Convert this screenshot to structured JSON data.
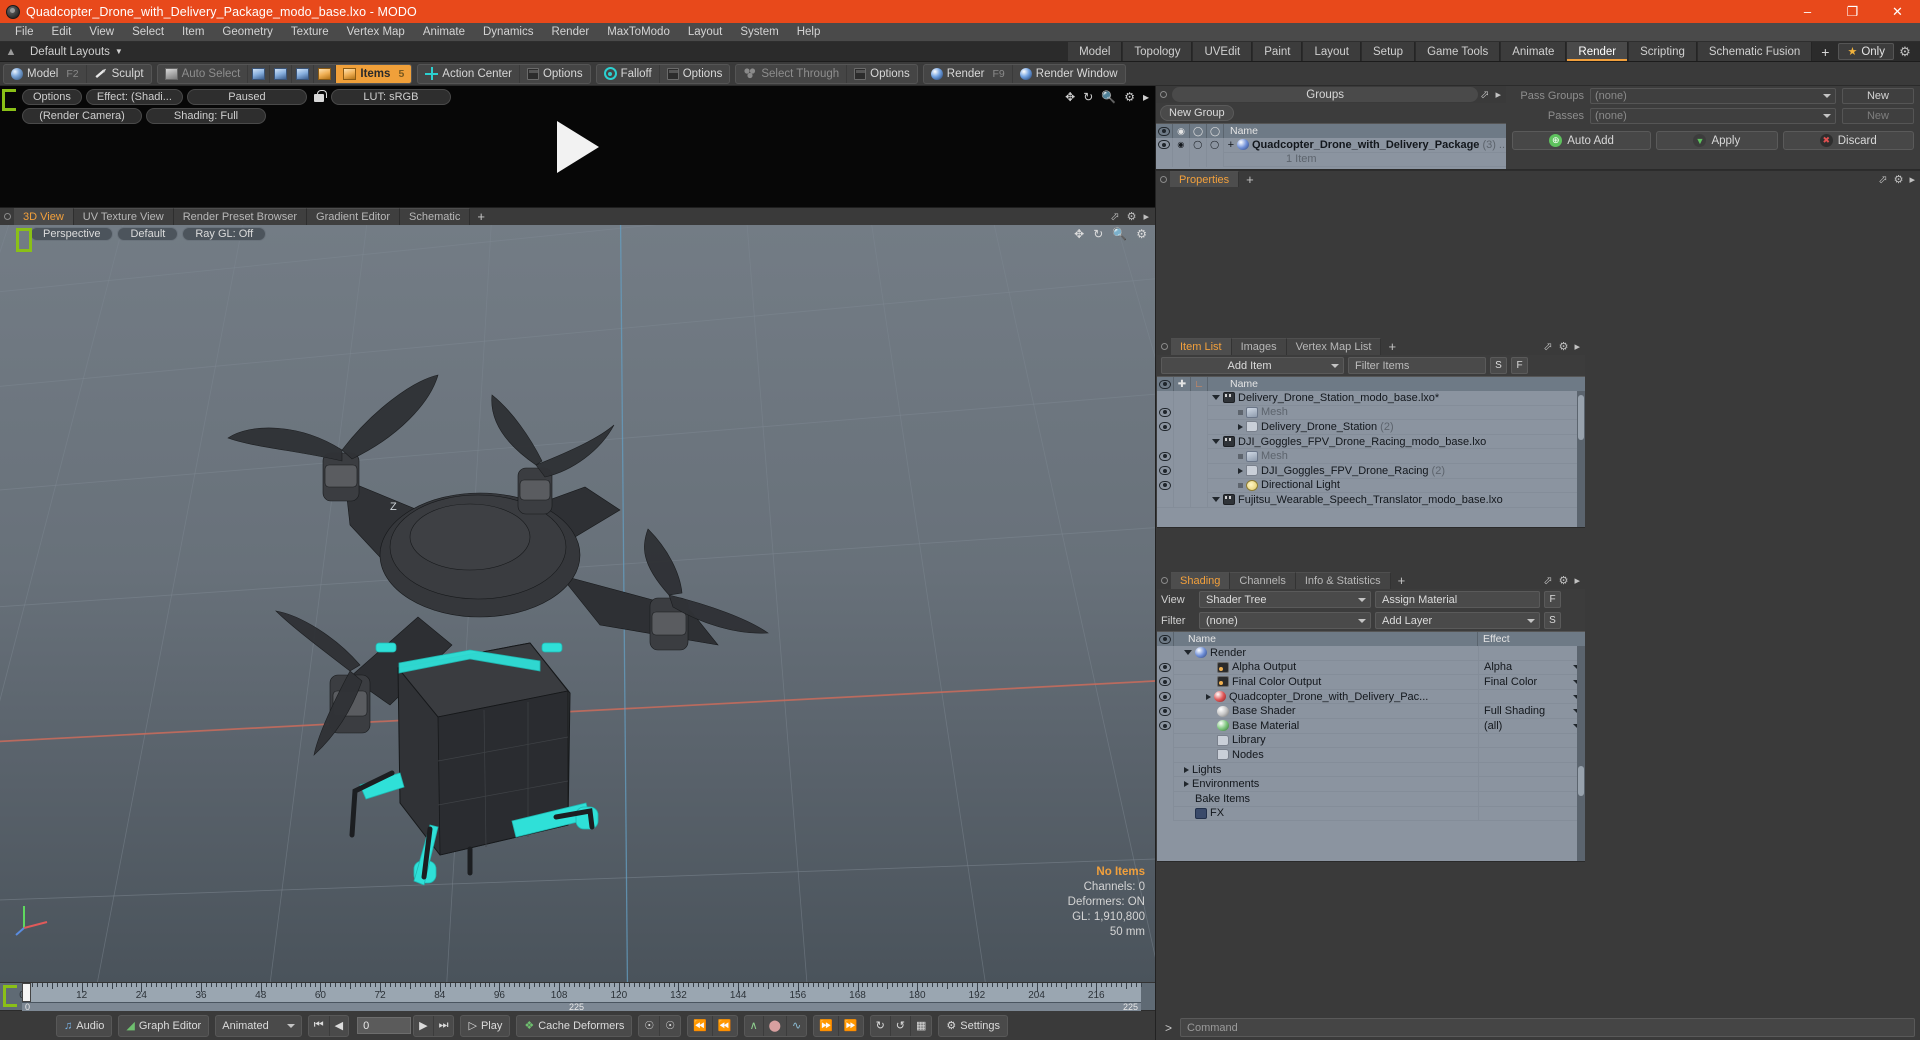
{
  "window": {
    "title": "Quadcopter_Drone_with_Delivery_Package_modo_base.lxo - MODO",
    "minimize": "–",
    "maximize": "❐",
    "close": "✕"
  },
  "menu": {
    "items": [
      "File",
      "Edit",
      "View",
      "Select",
      "Item",
      "Geometry",
      "Texture",
      "Vertex Map",
      "Animate",
      "Dynamics",
      "Render",
      "MaxToModo",
      "Layout",
      "System",
      "Help"
    ]
  },
  "layout_bar": {
    "default_layouts": "Default Layouts",
    "tabs": [
      {
        "label": "Model",
        "active": false
      },
      {
        "label": "Topology",
        "active": false
      },
      {
        "label": "UVEdit",
        "active": false
      },
      {
        "label": "Paint",
        "active": false
      },
      {
        "label": "Layout",
        "active": false
      },
      {
        "label": "Setup",
        "active": false
      },
      {
        "label": "Game Tools",
        "active": false
      },
      {
        "label": "Animate",
        "active": false
      },
      {
        "label": "Render",
        "active": true
      },
      {
        "label": "Scripting",
        "active": false
      },
      {
        "label": "Schematic Fusion",
        "active": false
      }
    ],
    "add_tab": "+",
    "only_label": "Only"
  },
  "toolbar": {
    "mode_group": [
      {
        "label": "Model",
        "key": "F2",
        "icon": "sphere-icon",
        "active": false
      },
      {
        "label": "Sculpt",
        "key": "",
        "icon": "brush-icon",
        "active": false
      }
    ],
    "auto_select": {
      "label": "Auto Select",
      "icon": "cube-icon"
    },
    "selection_modes": [
      "vertex-select-icon",
      "edge-select-icon",
      "polygon-select-icon",
      "material-select-icon"
    ],
    "items_btn": {
      "label": "Items",
      "key": "5",
      "icon": "items-cube-icon",
      "active": true
    },
    "action_center": {
      "label": "Action Center",
      "icon": "action-center-icon"
    },
    "options1": {
      "label": "Options",
      "icon": "options-box-icon"
    },
    "falloff": {
      "label": "Falloff",
      "icon": "falloff-icon"
    },
    "options2": {
      "label": "Options",
      "icon": "options-box-icon"
    },
    "select_through": {
      "label": "Select Through",
      "icon": "select-through-icon"
    },
    "options3": {
      "label": "Options",
      "icon": "options-box-icon"
    },
    "render": {
      "label": "Render",
      "key": "F9",
      "icon": "render-sphere-icon"
    },
    "render_window": {
      "label": "Render Window",
      "icon": "render-window-icon"
    }
  },
  "preview": {
    "options": "Options",
    "effect": "Effect: (Shadi...",
    "paused": "Paused",
    "lut": "LUT: sRGB",
    "camera": "(Render Camera)",
    "shading": "Shading: Full",
    "lock_icon": "unlocked-padlock-icon"
  },
  "viewport_tabs": {
    "tabs": [
      {
        "label": "3D View",
        "active": true
      },
      {
        "label": "UV Texture View",
        "active": false
      },
      {
        "label": "Render Preset Browser",
        "active": false
      },
      {
        "label": "Gradient Editor",
        "active": false
      },
      {
        "label": "Schematic",
        "active": false
      }
    ],
    "add_tab": "+"
  },
  "viewport": {
    "perspective": "Perspective",
    "preset": "Default",
    "raygl": "Ray GL: Off",
    "axis_z": "Z",
    "info": {
      "items": "No Items",
      "channels": "Channels: 0",
      "deformers": "Deformers: ON",
      "gl": "GL: 1,910,800",
      "scale": "50 mm"
    }
  },
  "timeline": {
    "ticks": [
      "0",
      "12",
      "24",
      "36",
      "48",
      "60",
      "72",
      "84",
      "96",
      "108",
      "120",
      "132",
      "144",
      "156",
      "168",
      "180",
      "192",
      "204",
      "216"
    ],
    "range_start": "0",
    "range_current": "225",
    "range_end": "225"
  },
  "bottom_bar": {
    "audio": "Audio",
    "graph_editor": "Graph Editor",
    "animated": "Animated",
    "frame_value": "0",
    "play": "Play",
    "cache_deformers": "Cache Deformers",
    "settings": "Settings",
    "transport": [
      "go-to-start-icon",
      "step-back-icon",
      "step-forward-icon",
      "go-to-end-icon"
    ],
    "key_tools": [
      "key-create-icon",
      "key-delete-icon",
      "prev-key-icon",
      "first-key-icon",
      "curve-icon",
      "ellipse-icon",
      "graph-icon",
      "next-key-icon",
      "last-key-icon",
      "reload-icon",
      "refresh-icon",
      "bake-icon"
    ]
  },
  "groups_panel": {
    "title": "Groups",
    "new_group": "New Group",
    "columns": [
      "visibility-col",
      "render-col",
      "shade-col",
      "wire-col",
      "Name"
    ],
    "rows": [
      {
        "name": "Quadcopter_Drone_with_Delivery_Package",
        "count": "(3)",
        "ellipsis": "...",
        "sub": "1 Item",
        "expander": "+"
      }
    ]
  },
  "pass_panel": {
    "pass_groups_label": "Pass Groups",
    "pass_groups_value": "(none)",
    "pass_groups_new": "New",
    "passes_label": "Passes",
    "passes_value": "(none)",
    "passes_new": "New",
    "auto_add": "Auto Add",
    "apply": "Apply",
    "discard": "Discard",
    "properties_tab": "Properties",
    "properties_plus": "+"
  },
  "item_list_panel": {
    "tabs": [
      {
        "label": "Item List",
        "active": true
      },
      {
        "label": "Images",
        "active": false
      },
      {
        "label": "Vertex Map List",
        "active": false
      }
    ],
    "add_tab": "+",
    "add_item": "Add Item",
    "filter_placeholder": "Filter Items",
    "btn_s": "S",
    "btn_f": "F",
    "columns": [
      "visibility-col",
      "lock-col",
      "axis-col",
      "Name"
    ],
    "rows": [
      {
        "indent": 1,
        "icon": "scene-icon",
        "name": "Delivery_Drone_Station_modo_base.lxo*",
        "count": "",
        "expander": "down",
        "eye": false,
        "dim": false
      },
      {
        "indent": 2,
        "icon": "mesh-icon",
        "name": "Mesh",
        "count": "",
        "expander": "none",
        "eye": true,
        "dim": true
      },
      {
        "indent": 2,
        "icon": "folder-icon",
        "name": "Delivery_Drone_Station",
        "count": "(2)",
        "expander": "right",
        "eye": true,
        "dim": false
      },
      {
        "indent": 1,
        "icon": "scene-icon",
        "name": "DJI_Goggles_FPV_Drone_Racing_modo_base.lxo",
        "count": "",
        "expander": "down",
        "eye": false,
        "dim": false
      },
      {
        "indent": 2,
        "icon": "mesh-icon",
        "name": "Mesh",
        "count": "",
        "expander": "none",
        "eye": true,
        "dim": true
      },
      {
        "indent": 2,
        "icon": "folder-icon",
        "name": "DJI_Goggles_FPV_Drone_Racing",
        "count": "(2)",
        "expander": "right",
        "eye": true,
        "dim": false
      },
      {
        "indent": 2,
        "icon": "light-icon",
        "name": "Directional Light",
        "count": "",
        "expander": "none",
        "eye": true,
        "dim": false
      },
      {
        "indent": 1,
        "icon": "scene-icon",
        "name": "Fujitsu_Wearable_Speech_Translator_modo_base.lxo",
        "count": "",
        "expander": "down",
        "eye": false,
        "dim": false
      }
    ]
  },
  "shading_panel": {
    "tabs": [
      {
        "label": "Shading",
        "active": true
      },
      {
        "label": "Channels",
        "active": false
      },
      {
        "label": "Info & Statistics",
        "active": false
      }
    ],
    "add_tab": "+",
    "view_label": "View",
    "view_value": "Shader Tree",
    "assign_material": "Assign Material",
    "btn_f": "F",
    "filter_label": "Filter",
    "filter_value": "(none)",
    "add_layer": "Add Layer",
    "btn_s": "S",
    "columns": [
      "visibility-col",
      "Name",
      "Effect"
    ],
    "rows": [
      {
        "indent": 1,
        "icon": "sphere-blue-icon",
        "name": "Render",
        "effect": "",
        "expander": "down",
        "eye": false,
        "caret": false
      },
      {
        "indent": 2,
        "icon": "image-icon",
        "name": "Alpha Output",
        "effect": "Alpha",
        "expander": "none",
        "eye": true,
        "caret": true
      },
      {
        "indent": 2,
        "icon": "image-icon",
        "name": "Final Color Output",
        "effect": "Final Color",
        "expander": "none",
        "eye": true,
        "caret": true
      },
      {
        "indent": 2,
        "icon": "sphere-red-icon",
        "name": "Quadcopter_Drone_with_Delivery_Pac...",
        "effect": "",
        "expander": "right",
        "eye": true,
        "caret": true
      },
      {
        "indent": 2,
        "icon": "sphere-grey-icon",
        "name": "Base Shader",
        "effect": "Full Shading",
        "expander": "none",
        "eye": true,
        "caret": true
      },
      {
        "indent": 2,
        "icon": "sphere-green-icon",
        "name": "Base Material",
        "effect": "(all)",
        "expander": "none",
        "eye": true,
        "caret": true
      },
      {
        "indent": 2,
        "icon": "folder-icon",
        "name": "Library",
        "effect": "",
        "expander": "none",
        "eye": false,
        "caret": false
      },
      {
        "indent": 2,
        "icon": "folder-icon",
        "name": "Nodes",
        "effect": "",
        "expander": "none",
        "eye": false,
        "caret": false
      },
      {
        "indent": 1,
        "icon": "none",
        "name": "Lights",
        "effect": "",
        "expander": "right",
        "eye": false,
        "caret": false
      },
      {
        "indent": 1,
        "icon": "none",
        "name": "Environments",
        "effect": "",
        "expander": "right",
        "eye": false,
        "caret": false
      },
      {
        "indent": 1,
        "icon": "none",
        "name": "Bake Items",
        "effect": "",
        "expander": "none",
        "eye": false,
        "caret": false
      },
      {
        "indent": 1,
        "icon": "fx-icon",
        "name": "FX",
        "effect": "",
        "expander": "none",
        "eye": false,
        "caret": false
      }
    ]
  },
  "command_bar": {
    "prompt": ">",
    "placeholder": "Command"
  },
  "colors": {
    "accent_orange": "#f2a03c",
    "title_bar": "#e8491b",
    "panel_bg": "#3c3c3c",
    "tree_bg": "#8b94a0",
    "cyan_highlight": "#2fe0d8"
  }
}
